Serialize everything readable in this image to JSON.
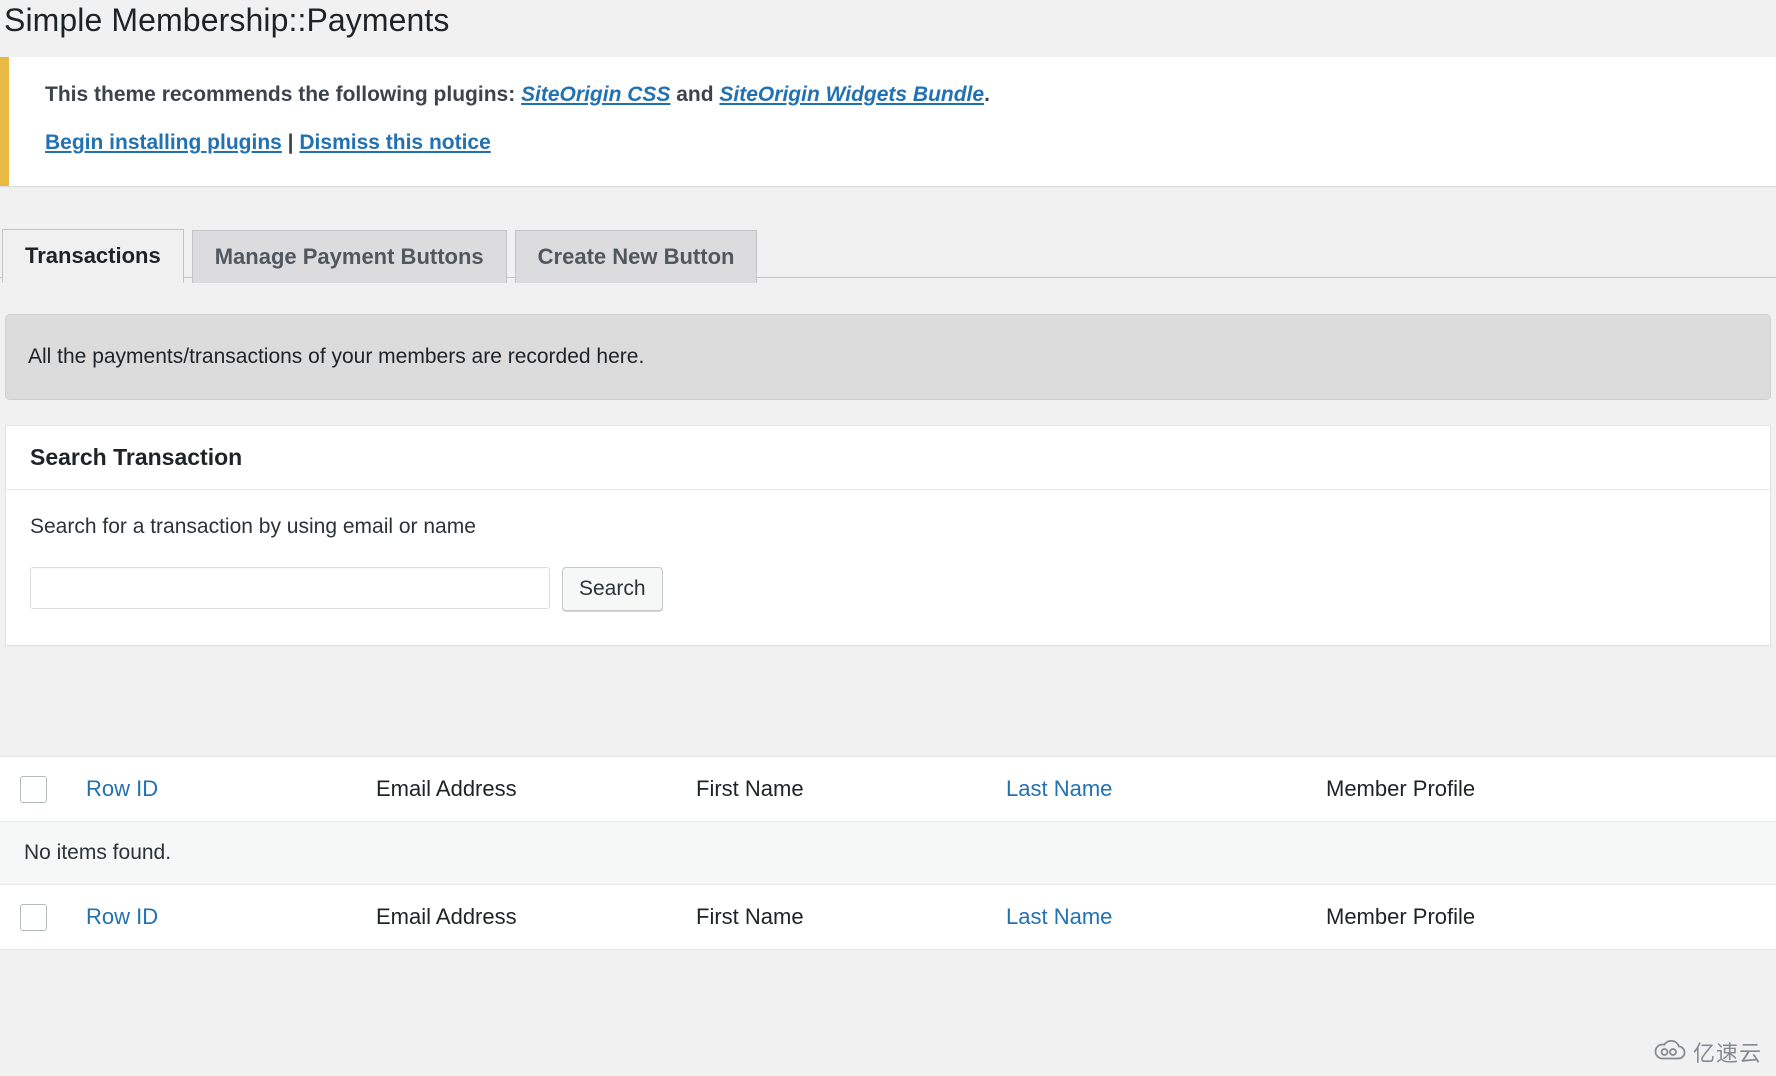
{
  "page": {
    "title": "Simple Membership::Payments"
  },
  "notice": {
    "accent_color": "#e8ba45",
    "message_prefix": "This theme recommends the following plugins: ",
    "plugin_links": [
      "SiteOrigin CSS",
      "SiteOrigin Widgets Bundle"
    ],
    "conjunction": " and ",
    "message_suffix": ".",
    "begin_install_label": "Begin installing plugins",
    "separator": " | ",
    "dismiss_label": "Dismiss this notice"
  },
  "tabs": [
    {
      "label": "Transactions",
      "active": true
    },
    {
      "label": "Manage Payment Buttons",
      "active": false
    },
    {
      "label": "Create New Button",
      "active": false
    }
  ],
  "info_panel": {
    "text": "All the payments/transactions of your members are recorded here."
  },
  "search_panel": {
    "heading": "Search Transaction",
    "description": "Search for a transaction by using email or name",
    "input_value": "",
    "input_placeholder": "",
    "button_label": "Search"
  },
  "table": {
    "columns": [
      {
        "label": "Row ID",
        "sortable": true
      },
      {
        "label": "Email Address",
        "sortable": false
      },
      {
        "label": "First Name",
        "sortable": false
      },
      {
        "label": "Last Name",
        "sortable": true
      },
      {
        "label": "Member Profile",
        "sortable": false
      }
    ],
    "rows": [],
    "empty_message": "No items found."
  },
  "watermark": {
    "text": "亿速云"
  },
  "colors": {
    "link": "#2271b1",
    "notice_accent": "#e8ba45",
    "page_background": "#f1f1f1",
    "panel_background": "#dcdcdc"
  }
}
